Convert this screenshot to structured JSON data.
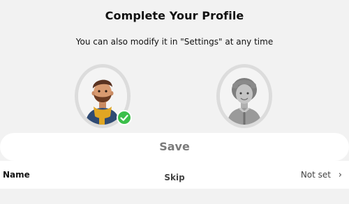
{
  "header": {
    "title": "Complete Your Profile",
    "subtitle": "You can also modify it in \"Settings\" at any time"
  },
  "avatars": [
    {
      "name": "male-avatar",
      "selected": true
    },
    {
      "name": "female-avatar",
      "selected": false
    }
  ],
  "actions": {
    "save_label": "Save",
    "skip_label": "Skip"
  },
  "profile_row": {
    "label": "Name",
    "value": "Not set",
    "chevron": "›"
  },
  "colors": {
    "background": "#f2f2f2",
    "check_badge": "#3bbf4a",
    "save_text": "#7a7a7a"
  }
}
